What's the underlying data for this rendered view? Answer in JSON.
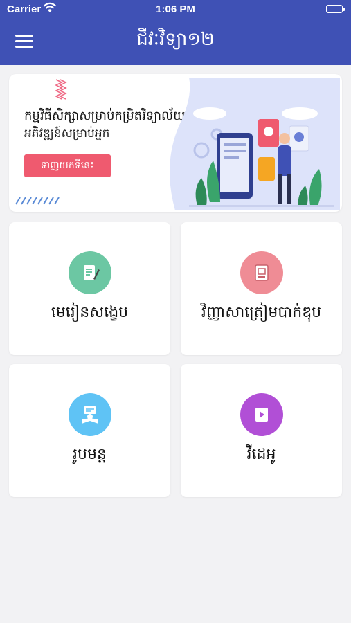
{
  "status_bar": {
    "carrier": "Carrier",
    "time": "1:06 PM"
  },
  "header": {
    "title": "ជីវៈវិទ្យា១២"
  },
  "banner": {
    "title": "កម្មវិធីសិក្សាសម្រាប់កម្រិតវិទ្យាល័យ",
    "subtitle": "អភិវឌ្ឍន៍សម្រាប់អ្នក",
    "button_label": "ទាញយកទីនេះ"
  },
  "menu": [
    {
      "label": "មេរៀនសង្ខេប",
      "icon": "notes-icon",
      "color": "#6cc7a3"
    },
    {
      "label": "វិញ្ញាសាត្រៀមបាក់ឌុប",
      "icon": "exam-book-icon",
      "color": "#ef8c95"
    },
    {
      "label": "រូបមន្ត",
      "icon": "formula-icon",
      "color": "#5fc3f5"
    },
    {
      "label": "វីដេអូ",
      "icon": "video-icon",
      "color": "#b14fd6"
    }
  ],
  "colors": {
    "header": "#3f51b5",
    "button": "#ef5a6f",
    "background": "#f2f2f4"
  }
}
